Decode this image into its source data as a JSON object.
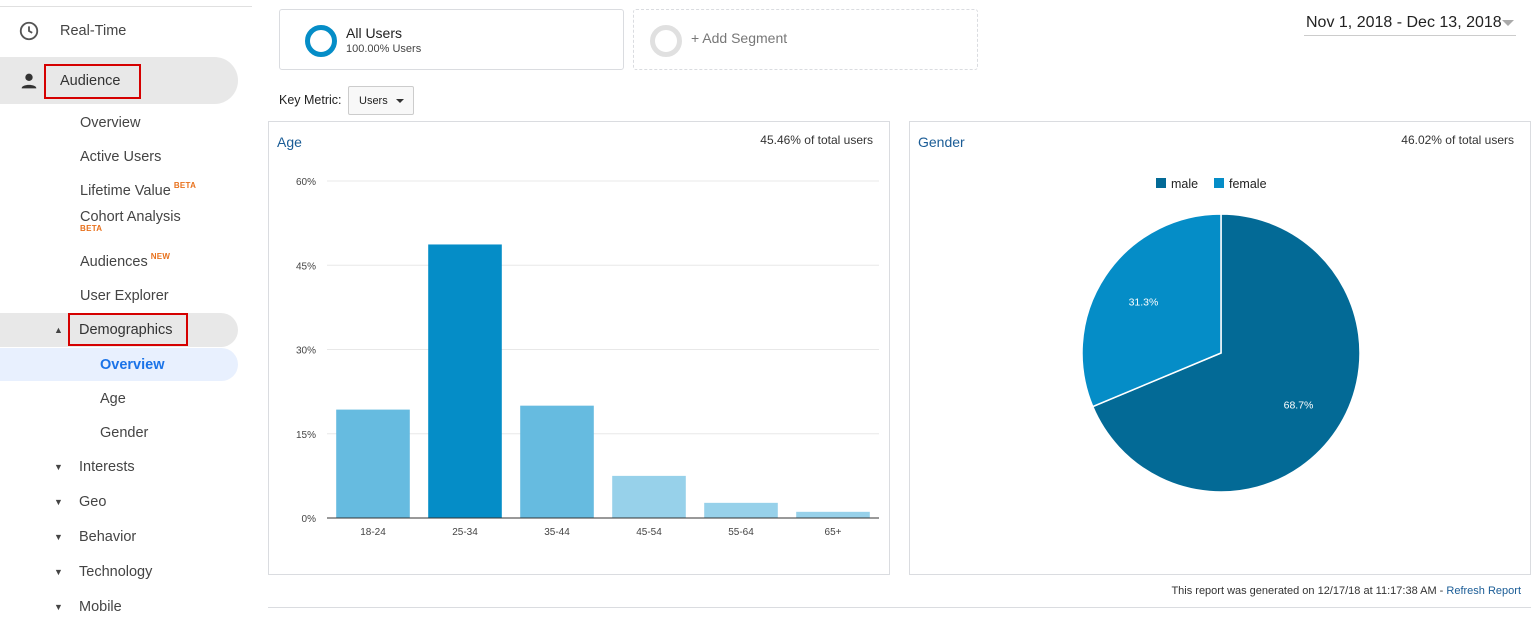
{
  "sidebar": {
    "realtime": "Real-Time",
    "audience": "Audience",
    "items": [
      {
        "label": "Overview"
      },
      {
        "label": "Active Users"
      },
      {
        "label": "Lifetime Value",
        "badge": "BETA"
      },
      {
        "label": "Cohort Analysis",
        "badge": "BETA"
      },
      {
        "label": "Audiences",
        "badge": "NEW"
      },
      {
        "label": "User Explorer"
      }
    ],
    "demographics": "Demographics",
    "demo_items": [
      "Overview",
      "Age",
      "Gender"
    ],
    "groups": [
      "Interests",
      "Geo",
      "Behavior",
      "Technology",
      "Mobile"
    ],
    "colors": {
      "highlight_border": "#d50000",
      "active_text": "#1a73e8",
      "badge": "#e8711c"
    }
  },
  "segments": {
    "all_users_name": "All Users",
    "all_users_sub": "100.00% Users",
    "add_segment": "+ Add Segment"
  },
  "date_range": "Nov 1, 2018 - Dec 13, 2018",
  "key_metric": {
    "label": "Key Metric:",
    "value": "Users"
  },
  "age_panel": {
    "title": "Age",
    "pct": "45.46% of total users"
  },
  "gender_panel": {
    "title": "Gender",
    "pct": "46.02% of total users"
  },
  "footer": {
    "text": "This report was generated on 12/17/18 at 11:17:38 AM - ",
    "link": "Refresh Report"
  },
  "chart_data": [
    {
      "type": "bar",
      "title": "Age",
      "categories": [
        "18-24",
        "25-34",
        "35-44",
        "45-54",
        "55-64",
        "65+"
      ],
      "values": [
        19.3,
        48.7,
        20.0,
        7.5,
        2.7,
        1.1
      ],
      "ylim": [
        0,
        60
      ],
      "yticks": [
        "0%",
        "15%",
        "30%",
        "45%",
        "60%"
      ],
      "grid": true,
      "colors": [
        "#66bbe0",
        "#058dc7",
        "#66bbe0",
        "#97d1ea",
        "#97d1ea",
        "#97d1ea"
      ]
    },
    {
      "type": "pie",
      "title": "Gender",
      "legend": "top",
      "slices": [
        {
          "name": "male",
          "value": 68.7,
          "label": "68.7%",
          "color": "#036a96"
        },
        {
          "name": "female",
          "value": 31.3,
          "label": "31.3%",
          "color": "#058dc7"
        }
      ]
    }
  ]
}
